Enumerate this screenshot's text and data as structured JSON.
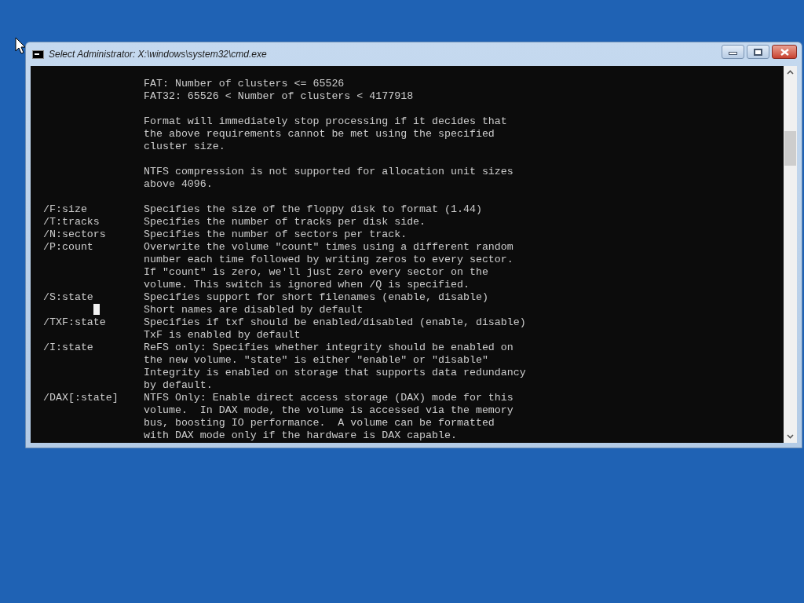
{
  "window": {
    "title": "Select Administrator: X:\\windows\\system32\\cmd.exe"
  },
  "console": {
    "lines": [
      {
        "kind": "text",
        "text": "FAT: Number of clusters <= 65526"
      },
      {
        "kind": "text",
        "text": "FAT32: 65526 < Number of clusters < 4177918"
      },
      {
        "kind": "blank"
      },
      {
        "kind": "text",
        "text": "Format will immediately stop processing if it decides that"
      },
      {
        "kind": "text",
        "text": "the above requirements cannot be met using the specified"
      },
      {
        "kind": "text",
        "text": "cluster size."
      },
      {
        "kind": "blank"
      },
      {
        "kind": "text",
        "text": "NTFS compression is not supported for allocation unit sizes"
      },
      {
        "kind": "text",
        "text": "above 4096."
      },
      {
        "kind": "blank"
      },
      {
        "kind": "text",
        "option": "/F:size",
        "text": "Specifies the size of the floppy disk to format (1.44)"
      },
      {
        "kind": "text",
        "option": "/T:tracks",
        "text": "Specifies the number of tracks per disk side."
      },
      {
        "kind": "text",
        "option": "/N:sectors",
        "text": "Specifies the number of sectors per track."
      },
      {
        "kind": "text",
        "option": "/P:count",
        "text": "Overwrite the volume \"count\" times using a different random"
      },
      {
        "kind": "text",
        "text": "number each time followed by writing zeros to every sector."
      },
      {
        "kind": "text",
        "text": "If \"count\" is zero, we'll just zero every sector on the"
      },
      {
        "kind": "text",
        "text": "volume. This switch is ignored when /Q is specified."
      },
      {
        "kind": "text",
        "option": "/S:state",
        "text": "Specifies support for short filenames (enable, disable)"
      },
      {
        "kind": "text",
        "cursor": true,
        "text": "Short names are disabled by default"
      },
      {
        "kind": "text",
        "option": "/TXF:state",
        "text": "Specifies if txf should be enabled/disabled (enable, disable)"
      },
      {
        "kind": "text",
        "text": "TxF is enabled by default"
      },
      {
        "kind": "text",
        "option": "/I:state",
        "text": "ReFS only: Specifies whether integrity should be enabled on"
      },
      {
        "kind": "text",
        "text": "the new volume. \"state\" is either \"enable\" or \"disable\""
      },
      {
        "kind": "text",
        "text": "Integrity is enabled on storage that supports data redundancy"
      },
      {
        "kind": "text",
        "text": "by default."
      },
      {
        "kind": "text",
        "option": "/DAX[:state]",
        "text": "NTFS Only: Enable direct access storage (DAX) mode for this"
      },
      {
        "kind": "text",
        "text": "volume.  In DAX mode, the volume is accessed via the memory"
      },
      {
        "kind": "text",
        "text": "bus, boosting IO performance.  A volume can be formatted"
      },
      {
        "kind": "text",
        "text": "with DAX mode only if the hardware is DAX capable."
      }
    ]
  }
}
